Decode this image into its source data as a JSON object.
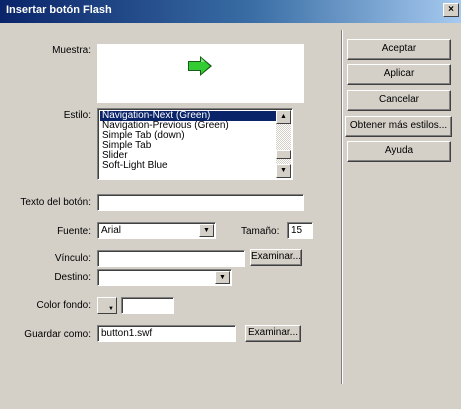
{
  "window": {
    "title": "Insertar botón Flash",
    "close_label": "×"
  },
  "form": {
    "sample_label": "Muestra:",
    "style_label": "Estilo:",
    "styles": [
      "Navigation-Next (Green)",
      "Navigation-Previous (Green)",
      "Simple Tab (down)",
      "Simple Tab",
      "Slider",
      "Soft-Light Blue"
    ],
    "selected_style_index": 0,
    "button_text_label": "Texto del botón:",
    "button_text_value": "",
    "font_label": "Fuente:",
    "font_value": "Arial",
    "size_label": "Tamaño:",
    "size_value": "15",
    "link_label": "Vínculo:",
    "link_value": "",
    "browse_label": "Examinar...",
    "target_label": "Destino:",
    "target_value": "",
    "bg_color_label": "Color fondo:",
    "bg_color_value": "",
    "save_as_label": "Guardar como:",
    "save_as_value": "button1.swf",
    "browse2_label": "Examinar..."
  },
  "buttons": {
    "ok": "Aceptar",
    "apply": "Aplicar",
    "cancel": "Cancelar",
    "more_styles": "Obtener más estilos...",
    "help": "Ayuda"
  },
  "colors": {
    "title_bar": "#0a246a",
    "face": "#d4d0c8",
    "preview_arrow": "#33cc33"
  },
  "icons": {
    "preview": "green-next-arrow-icon",
    "close": "close-icon"
  }
}
